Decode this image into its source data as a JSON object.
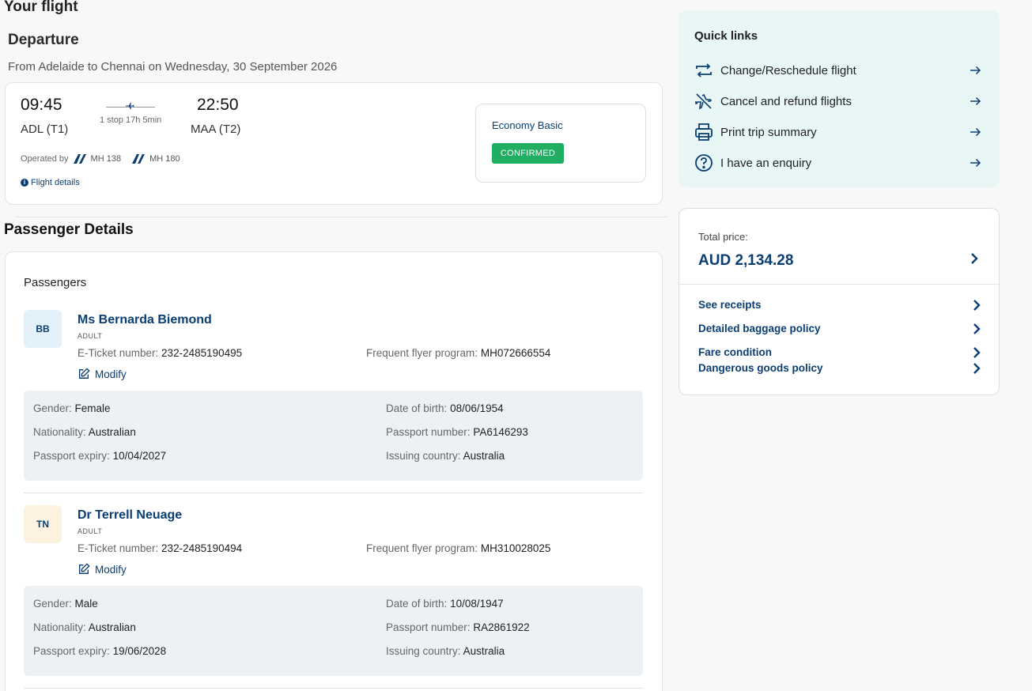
{
  "page": {
    "title": "Your flight"
  },
  "departure": {
    "title": "Departure",
    "subtitle": "From Adelaide to Chennai on Wednesday, 30 September 2026",
    "dep_time": "09:45",
    "dep_airport": "ADL (T1)",
    "arr_time": "22:50",
    "arr_airport": "MAA (T2)",
    "stops": "1 stop 17h 5min",
    "operated_label": "Operated by",
    "flights": [
      "MH 138",
      "MH 180"
    ],
    "details_link": "Flight details",
    "fare_name": "Economy Basic",
    "status": "CONFIRMED"
  },
  "passengers_section": {
    "title": "Passenger Details",
    "subtitle": "Passengers",
    "labels": {
      "eticket": "E-Ticket number",
      "ffp": "Frequent flyer program",
      "modify": "Modify",
      "gender": "Gender",
      "dob": "Date of birth",
      "nationality": "Nationality",
      "passport_no": "Passport number",
      "passport_exp": "Passport expiry",
      "issuing": "Issuing country"
    },
    "list": [
      {
        "initials": "BB",
        "name": "Ms Bernarda Biemond",
        "type": "ADULT",
        "eticket": "232-2485190495",
        "ffp": "MH072666554",
        "gender": "Female",
        "dob": "08/06/1954",
        "nationality": "Australian",
        "passport_no": "PA6146293",
        "passport_exp": "10/04/2027",
        "issuing": "Australia"
      },
      {
        "initials": "TN",
        "name": "Dr Terrell Neuage",
        "type": "ADULT",
        "eticket": "232-2485190494",
        "ffp": "MH310028025",
        "gender": "Male",
        "dob": "10/08/1947",
        "nationality": "Australian",
        "passport_no": "RA2861922",
        "passport_exp": "19/06/2028",
        "issuing": "Australia"
      }
    ]
  },
  "quick_links": {
    "title": "Quick links",
    "items": [
      {
        "label": "Change/Reschedule flight",
        "icon": "swap-icon"
      },
      {
        "label": "Cancel and refund flights",
        "icon": "no-flight-icon"
      },
      {
        "label": "Print trip summary",
        "icon": "printer-icon"
      },
      {
        "label": "I have an enquiry",
        "icon": "question-icon"
      }
    ]
  },
  "price": {
    "label": "Total price:",
    "value": "AUD 2,134.28",
    "links": [
      "See receipts",
      "Detailed baggage policy",
      "Fare condition",
      "Dangerous goods policy"
    ]
  },
  "colors": {
    "navy": "#0a3e73",
    "confirmed": "#1fae62",
    "quick_bg": "#e8f7f6"
  }
}
